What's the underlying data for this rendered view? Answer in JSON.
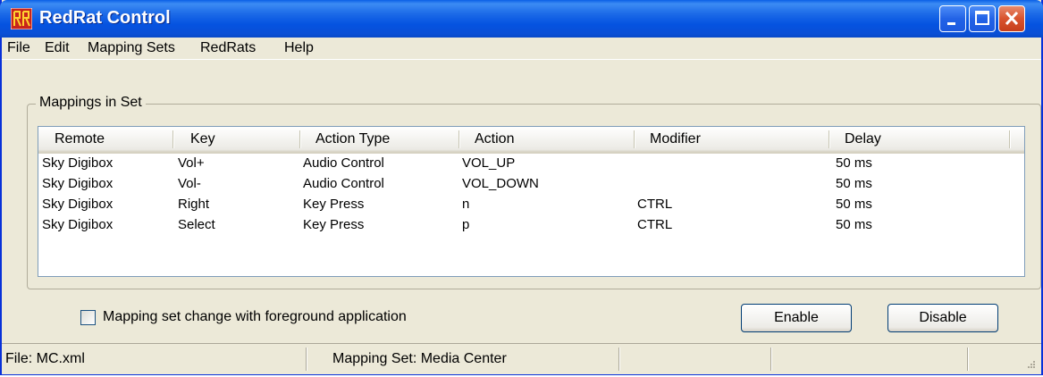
{
  "window": {
    "title": "RedRat Control"
  },
  "menu": {
    "items": [
      "File",
      "Edit",
      "Mapping Sets",
      "RedRats",
      "Help"
    ]
  },
  "group": {
    "label": "Mappings in Set"
  },
  "table": {
    "columns": [
      "Remote",
      "Key",
      "Action Type",
      "Action",
      "Modifier",
      "Delay"
    ],
    "rows": [
      [
        "Sky Digibox",
        "Vol+",
        "Audio Control",
        "VOL_UP",
        "",
        "50 ms"
      ],
      [
        "Sky Digibox",
        "Vol-",
        "Audio Control",
        "VOL_DOWN",
        "",
        "50 ms"
      ],
      [
        "Sky Digibox",
        "Right",
        "Key Press",
        "n",
        "CTRL",
        "50 ms"
      ],
      [
        "Sky Digibox",
        "Select",
        "Key Press",
        "p",
        "CTRL",
        "50 ms"
      ]
    ]
  },
  "options": {
    "foreground_checkbox_label": "Mapping set change with foreground application",
    "foreground_checked": false
  },
  "buttons": {
    "enable": "Enable",
    "disable": "Disable"
  },
  "status": {
    "file": "File: MC.xml",
    "mapping_set": "Mapping Set: Media Center"
  },
  "colors": {
    "titlebar": "#0a4fd6",
    "close": "#d8532e",
    "face": "#ece9d8",
    "app_icon": "#c8251b"
  }
}
